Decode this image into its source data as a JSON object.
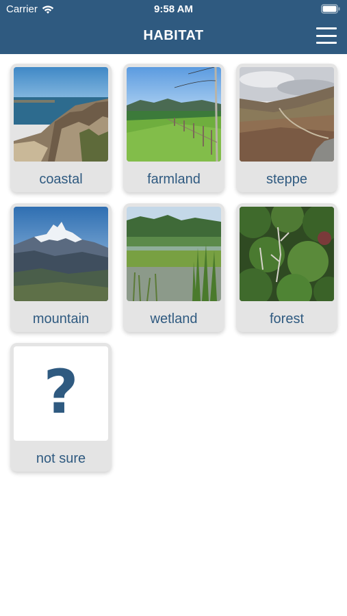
{
  "status_bar": {
    "carrier": "Carrier",
    "time": "9:58 AM",
    "icons": [
      "wifi-icon",
      "battery-icon"
    ]
  },
  "header": {
    "title": "HABITAT",
    "menu_icon": "hamburger-menu-icon"
  },
  "colors": {
    "header_bg": "#2f5a80",
    "label_text": "#2f5a80",
    "card_bg": "#e4e4e4"
  },
  "habitats": [
    {
      "label": "coastal"
    },
    {
      "label": "farmland"
    },
    {
      "label": "steppe"
    },
    {
      "label": "mountain"
    },
    {
      "label": "wetland"
    },
    {
      "label": "forest"
    },
    {
      "label": "not sure",
      "symbol": "?"
    }
  ]
}
